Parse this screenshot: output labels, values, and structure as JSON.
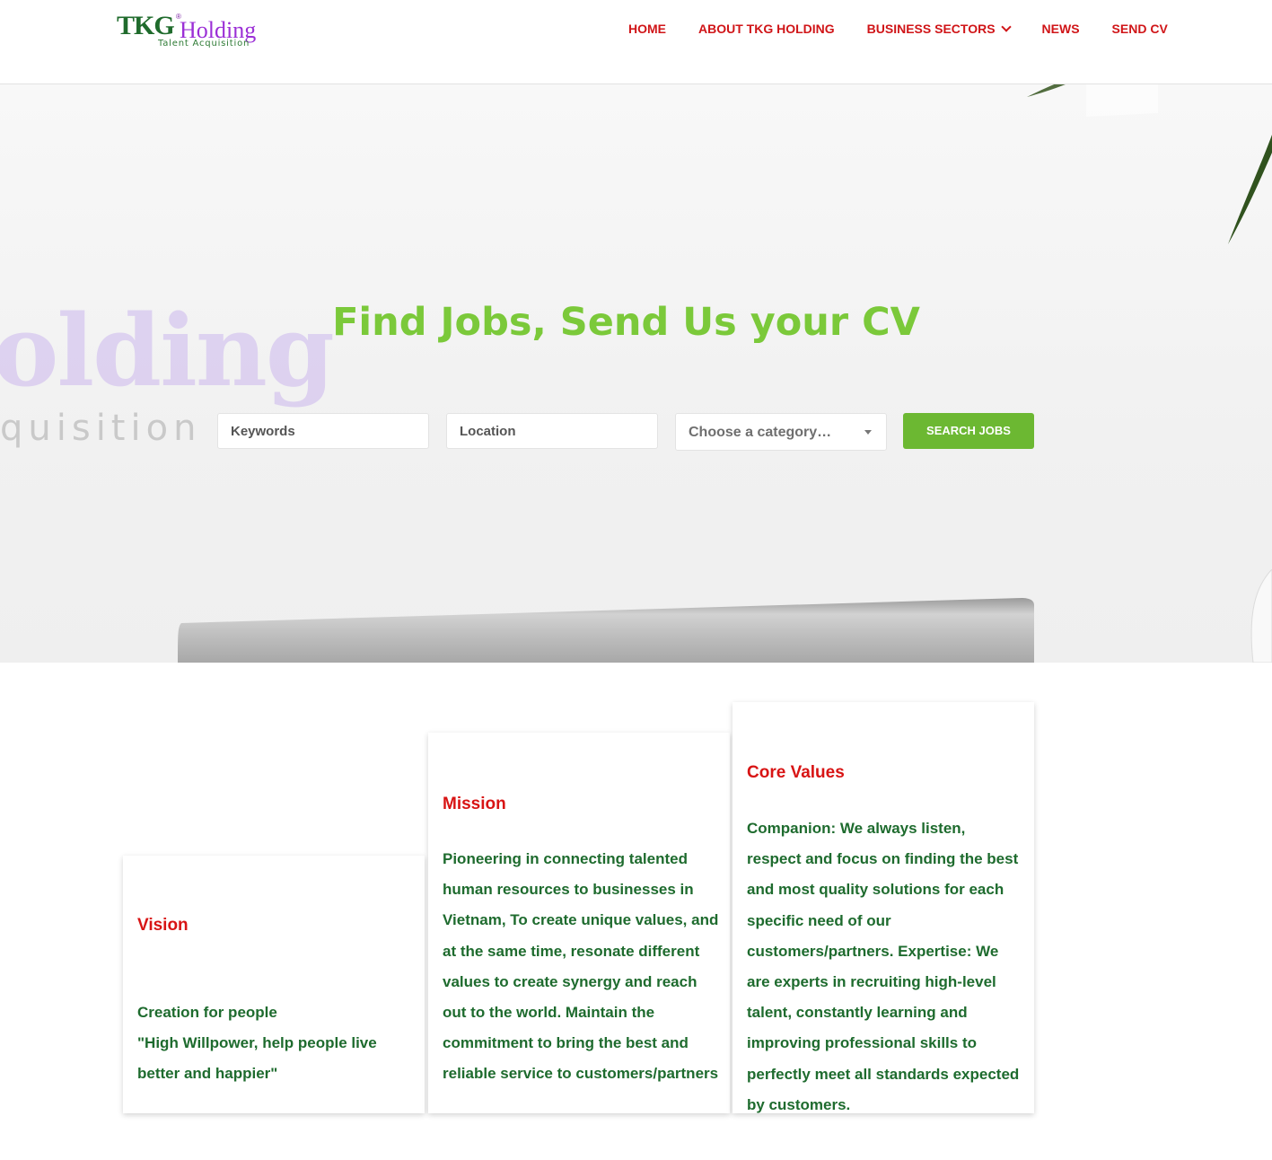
{
  "brand": {
    "tkg": "TKG",
    "registered": "®",
    "holding": "Holding",
    "tagline": "Talent Acquisition",
    "watermark_main": "olding",
    "watermark_sub": "quisition"
  },
  "nav": {
    "items": [
      {
        "label": "HOME"
      },
      {
        "label": "ABOUT TKG HOLDING"
      },
      {
        "label": "BUSINESS SECTORS",
        "dropdown": true
      },
      {
        "label": "NEWS"
      },
      {
        "label": "SEND CV"
      }
    ]
  },
  "hero": {
    "title": "Find Jobs, Send Us your CV",
    "keywords_placeholder": "Keywords",
    "location_placeholder": "Location",
    "category_selected": "Choose a category…",
    "search_button": "SEARCH JOBS"
  },
  "cards": {
    "vision": {
      "title": "Vision",
      "lines": [
        "Creation for people",
        "\"High Willpower, help people live better and happier\""
      ]
    },
    "mission": {
      "title": "Mission",
      "text": "Pioneering in connecting talented human resources to businesses in Vietnam, To create unique values, and at the same time, resonate different values to create synergy and reach out to the world. Maintain the commitment to bring the best and reliable service to customers/partners"
    },
    "core_values": {
      "title": "Core Values",
      "text": "Companion: We always listen, respect and focus on finding the best and most quality solutions for each specific need of our customers/partners. Expertise: We are experts in recruiting high-level talent, constantly learning and improving professional skills to perfectly meet all standards expected by customers."
    }
  },
  "colors": {
    "nav_red": "#d01518",
    "hero_green": "#7bc93a",
    "button_green": "#6cb832",
    "card_title_red": "#d81414",
    "card_text_green": "#1e6b2e"
  }
}
